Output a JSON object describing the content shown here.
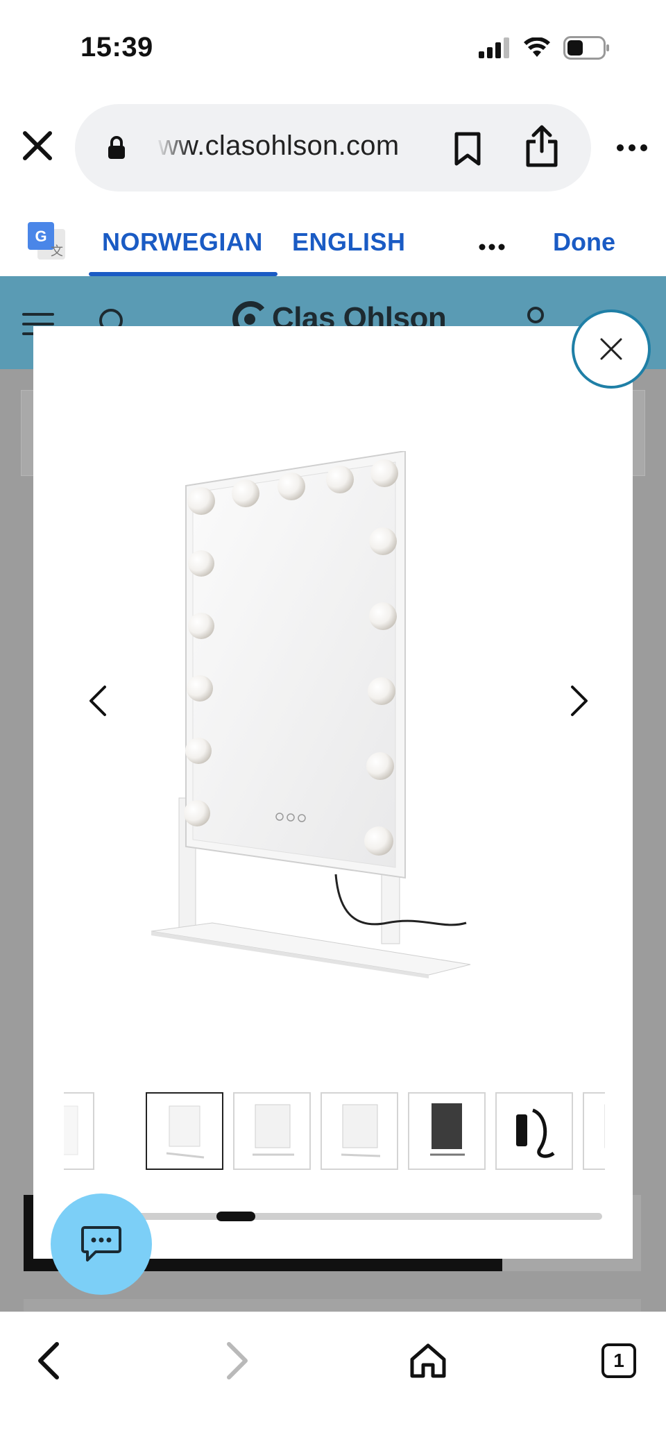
{
  "status_bar": {
    "time": "15:39"
  },
  "browser": {
    "url": "ww.clasohlson.com",
    "translate": {
      "tabs": [
        "NORWEGIAN",
        "ENGLISH"
      ],
      "done": "Done"
    },
    "tab_count": "1"
  },
  "site": {
    "logo_text": "Clas Ohlson"
  },
  "gallery": {
    "thumbnails": [
      "mirror-front-faded",
      "mirror-front",
      "mirror-angle-1",
      "mirror-angle-2",
      "mirror-back",
      "power-adapter",
      "mirror-side"
    ],
    "selected_index": 1,
    "scroll_position_fraction": 0.21
  },
  "colors": {
    "brand_header": "#5a9bb4",
    "translate_accent": "#1a5bc4",
    "modal_close_ring": "#1f7fa6",
    "chat_button": "#7ccff7"
  }
}
